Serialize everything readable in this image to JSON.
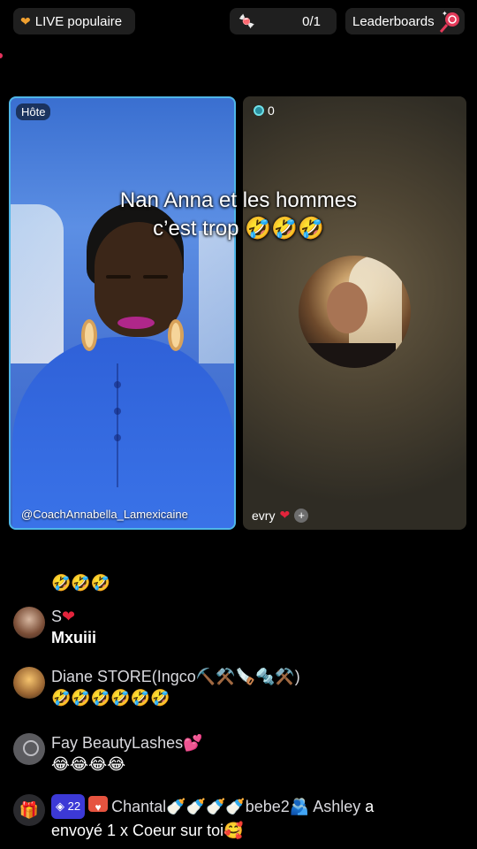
{
  "top_bar": {
    "live_label": "LIVE populaire",
    "gift_count": "0/1",
    "leaderboards_label": "Leaderboards"
  },
  "host_panel": {
    "badge": "Hôte",
    "username": "@CoachAnnabella_Lamexicaine"
  },
  "guest_panel": {
    "viewer_count": "0",
    "username": "evry",
    "add_label": "+"
  },
  "caption": {
    "line1": "Nan Anna et les hommes",
    "line2": "c’est trop 🤣🤣🤣"
  },
  "comments": {
    "c0_emojis": "🤣🤣🤣",
    "c1": {
      "name": "S",
      "message": "Mxuiii"
    },
    "c2": {
      "name": "Diane STORE(Ingco⛏️⚒️🪚🔩⚒️)",
      "message": "🤣🤣🤣🤣🤣🤣"
    },
    "c3": {
      "name": "Fay BeautyLashes💕",
      "message": "😂😂😂😂"
    },
    "c4": {
      "rank": "22",
      "name": "Chantal🍼🍼🍼🍼bebe2🫂 Ashley",
      "text": " a envoyé 1 x Coeur sur toi🥰"
    }
  }
}
